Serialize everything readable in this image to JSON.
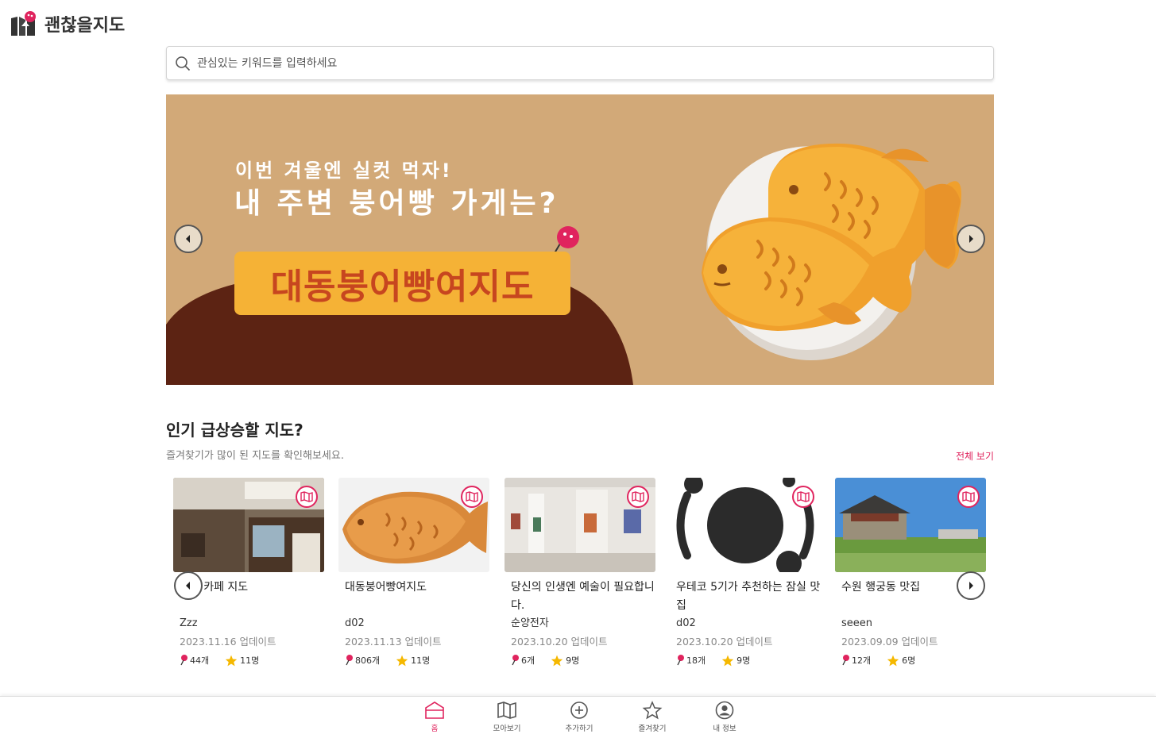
{
  "header": {
    "logo_text": "괜찮을지도"
  },
  "search": {
    "placeholder": "관심있는 키워드를 입력하세요"
  },
  "banner": {
    "subtitle": "이번 겨울엔 실컷 먹자!",
    "title": "내 주변 붕어빵 가게는?",
    "tag": "대동붕어빵여지도",
    "bg_color": "#d2a978"
  },
  "section": {
    "title": "인기 급상승할 지도?",
    "subtitle": "즐겨찾기가 많이 된 지도를 확인해보세요.",
    "see_all": "전체 보기"
  },
  "cards": [
    {
      "title": "전국 카페 지도",
      "author": "Zzz",
      "date": "2023.11.16 업데이트",
      "pins": "44개",
      "stars": "11명"
    },
    {
      "title": "대동붕어빵여지도",
      "author": "d02",
      "date": "2023.11.13 업데이트",
      "pins": "806개",
      "stars": "11명"
    },
    {
      "title": "당신의 인생엔 예술이 필요합니다.",
      "author": "순양전자",
      "date": "2023.10.20 업데이트",
      "pins": "6개",
      "stars": "9명"
    },
    {
      "title": "우테코 5기가 추천하는 잠실 맛집",
      "author": "d02",
      "date": "2023.10.20 업데이트",
      "pins": "18개",
      "stars": "9명"
    },
    {
      "title": "수원 행궁동 맛집",
      "author": "seeen",
      "date": "2023.09.09 업데이트",
      "pins": "12개",
      "stars": "6명"
    }
  ],
  "nav": {
    "items": [
      {
        "label": "홈",
        "icon": "home-icon"
      },
      {
        "label": "모아보기",
        "icon": "map-icon"
      },
      {
        "label": "추가하기",
        "icon": "plus-circle-icon"
      },
      {
        "label": "즐겨찾기",
        "icon": "star-icon"
      },
      {
        "label": "내 정보",
        "icon": "profile-icon"
      }
    ]
  },
  "colors": {
    "accent": "#e0245e",
    "pin": "#e0245e",
    "star": "#f5b800"
  }
}
